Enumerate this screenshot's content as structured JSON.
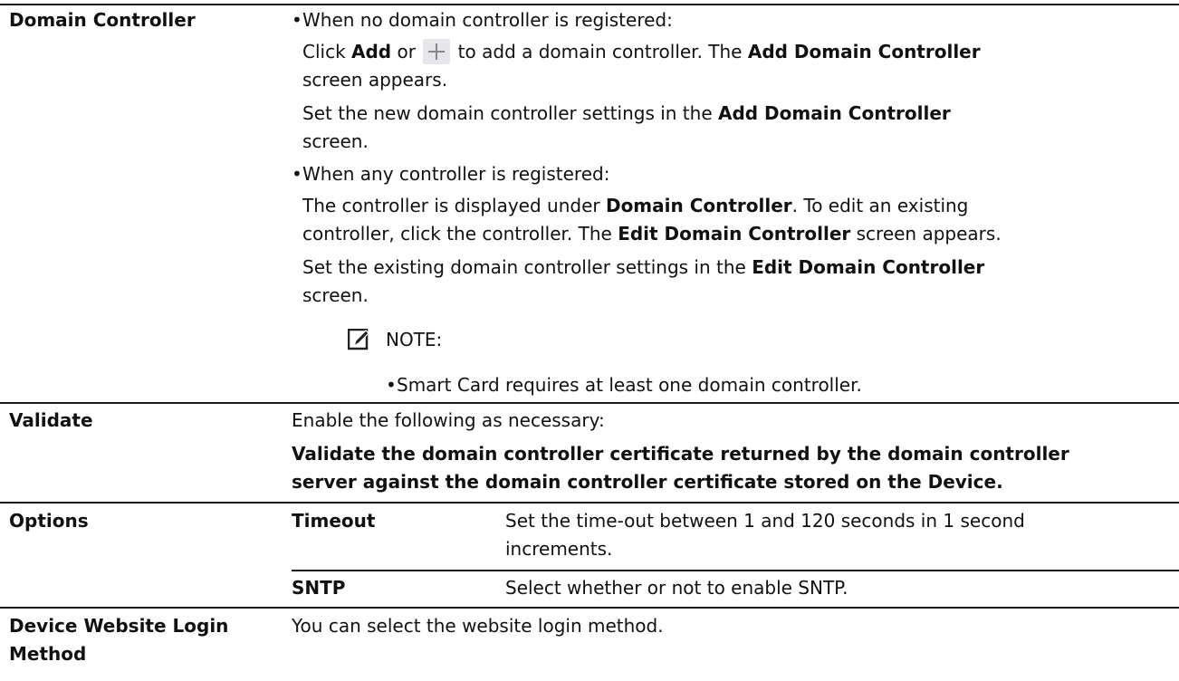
{
  "domain_controller": {
    "label": "Domain Controller",
    "bullet1": "When no domain controller is registered:",
    "p1": {
      "a": "Click ",
      "b": "Add",
      "c": " or ",
      "d": " to add a domain controller. The ",
      "e": "Add Domain Controller",
      "f": "screen appears."
    },
    "p2": {
      "a": "Set the new domain controller settings in the ",
      "b": "Add Domain Controller",
      "c": "screen."
    },
    "bullet2": "When any controller is registered:",
    "p3": {
      "a": "The controller is displayed under ",
      "b": "Domain Controller",
      "c": ". To edit an existing",
      "d": "controller, click the controller. The ",
      "e": "Edit Domain Controller",
      "f": " screen appears."
    },
    "p4": {
      "a": "Set the existing domain controller settings in the ",
      "b": "Edit Domain Controller",
      "c": "screen."
    },
    "note_title": "NOTE:",
    "note_item": "Smart Card requires at least one domain controller."
  },
  "validate": {
    "label": "Validate",
    "intro": "Enable the following as necessary:",
    "line1": "Validate the domain controller certificate returned by the domain controller",
    "line2": "server against the domain controller certificate stored on the Device."
  },
  "options": {
    "label": "Options",
    "timeout_label": "Timeout",
    "timeout_line1": "Set the time-out between 1 and 120 seconds in 1 second",
    "timeout_line2": "increments.",
    "sntp_label": "SNTP",
    "sntp_text": "Select whether or not to enable SNTP."
  },
  "login": {
    "label_line1": "Device Website Login",
    "label_line2": "Method",
    "text": "You can select the website login method."
  }
}
